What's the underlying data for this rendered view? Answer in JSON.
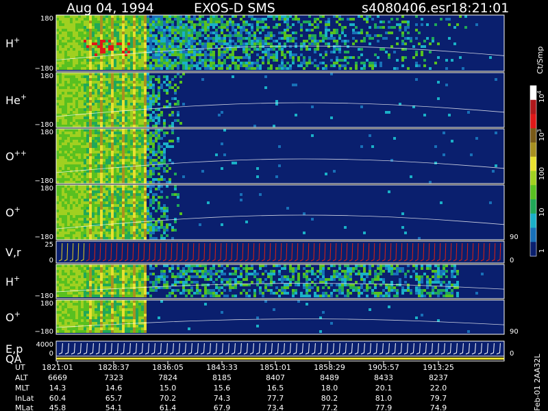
{
  "header": {
    "date": "Aug 04, 1994",
    "mission": "EXOS-D SMS",
    "file": "s4080406.esr",
    "time": "18:21:01"
  },
  "colors": {
    "background": "#0a1f6e",
    "frame": "#ffffff",
    "trace": "#ffffff",
    "velocity_trace": "#e02010",
    "velocity_trace_alt": "#e8d020",
    "qa_bar": "#e8e030"
  },
  "chart_data": {
    "type": "heatmap",
    "panels": [
      {
        "label_base": "H",
        "label_sup": "+",
        "ytop": "180",
        "ybot": "−180"
      },
      {
        "label_base": "He",
        "label_sup": "+",
        "ytop": "180",
        "ybot": "−180"
      },
      {
        "label_base": "O",
        "label_sup": "++",
        "ytop": "180",
        "ybot": "−180"
      },
      {
        "label_base": "O",
        "label_sup": "+",
        "ytop": "180",
        "ybot": "−180",
        "right_tick": "90"
      },
      {
        "label_base": "V,r",
        "label_sup": "",
        "ytop": "25",
        "ybot": "0",
        "right_tick": "0"
      },
      {
        "label_base": "H",
        "label_sup": "+",
        "ytop": "",
        "ybot": "−180"
      },
      {
        "label_base": "O",
        "label_sup": "+",
        "ytop": "180",
        "ybot": "−180",
        "right_tick": "90"
      },
      {
        "label_base": "E,p",
        "label_sup": "",
        "ytop": "4000",
        "ybot": "0",
        "right_tick": "0"
      },
      {
        "label_base": "QA",
        "label_sup": "",
        "ytop": "",
        "ybot": ""
      }
    ],
    "colorbar": {
      "unit_label": "Ct/Smp",
      "ticks": [
        {
          "base": "10",
          "exp": "4"
        },
        {
          "base": "10",
          "exp": "3"
        },
        {
          "base": "100",
          "exp": ""
        },
        {
          "base": "10",
          "exp": ""
        },
        {
          "base": "1",
          "exp": ""
        }
      ],
      "colors": [
        "#ffffff",
        "#b0181b",
        "#e01818",
        "#7a5a18",
        "#a89020",
        "#e8e030",
        "#a0d020",
        "#58c020",
        "#20a858",
        "#1ab0c8",
        "#1870b8",
        "#0a1f6e"
      ]
    },
    "xaxis": {
      "row_labels": [
        "UT",
        "ALT",
        "MLT",
        "InLat",
        "MLat"
      ],
      "columns": [
        [
          "1821:01",
          "6669",
          "14.3",
          "60.4",
          "45.8"
        ],
        [
          "1828:37",
          "7323",
          "14.6",
          "65.7",
          "54.1"
        ],
        [
          "1836:05",
          "7824",
          "15.0",
          "70.2",
          "61.4"
        ],
        [
          "1843:33",
          "8185",
          "15.6",
          "74.3",
          "67.9"
        ],
        [
          "1851:01",
          "8407",
          "16.5",
          "77.7",
          "73.4"
        ],
        [
          "1858:29",
          "8489",
          "18.0",
          "80.2",
          "77.2"
        ],
        [
          "1905:57",
          "8433",
          "20.1",
          "81.0",
          "77.9"
        ],
        [
          "1913:25",
          "8237",
          "22.0",
          "79.7",
          "74.9"
        ]
      ]
    },
    "side_note": "Feb-01 2AA32L"
  }
}
